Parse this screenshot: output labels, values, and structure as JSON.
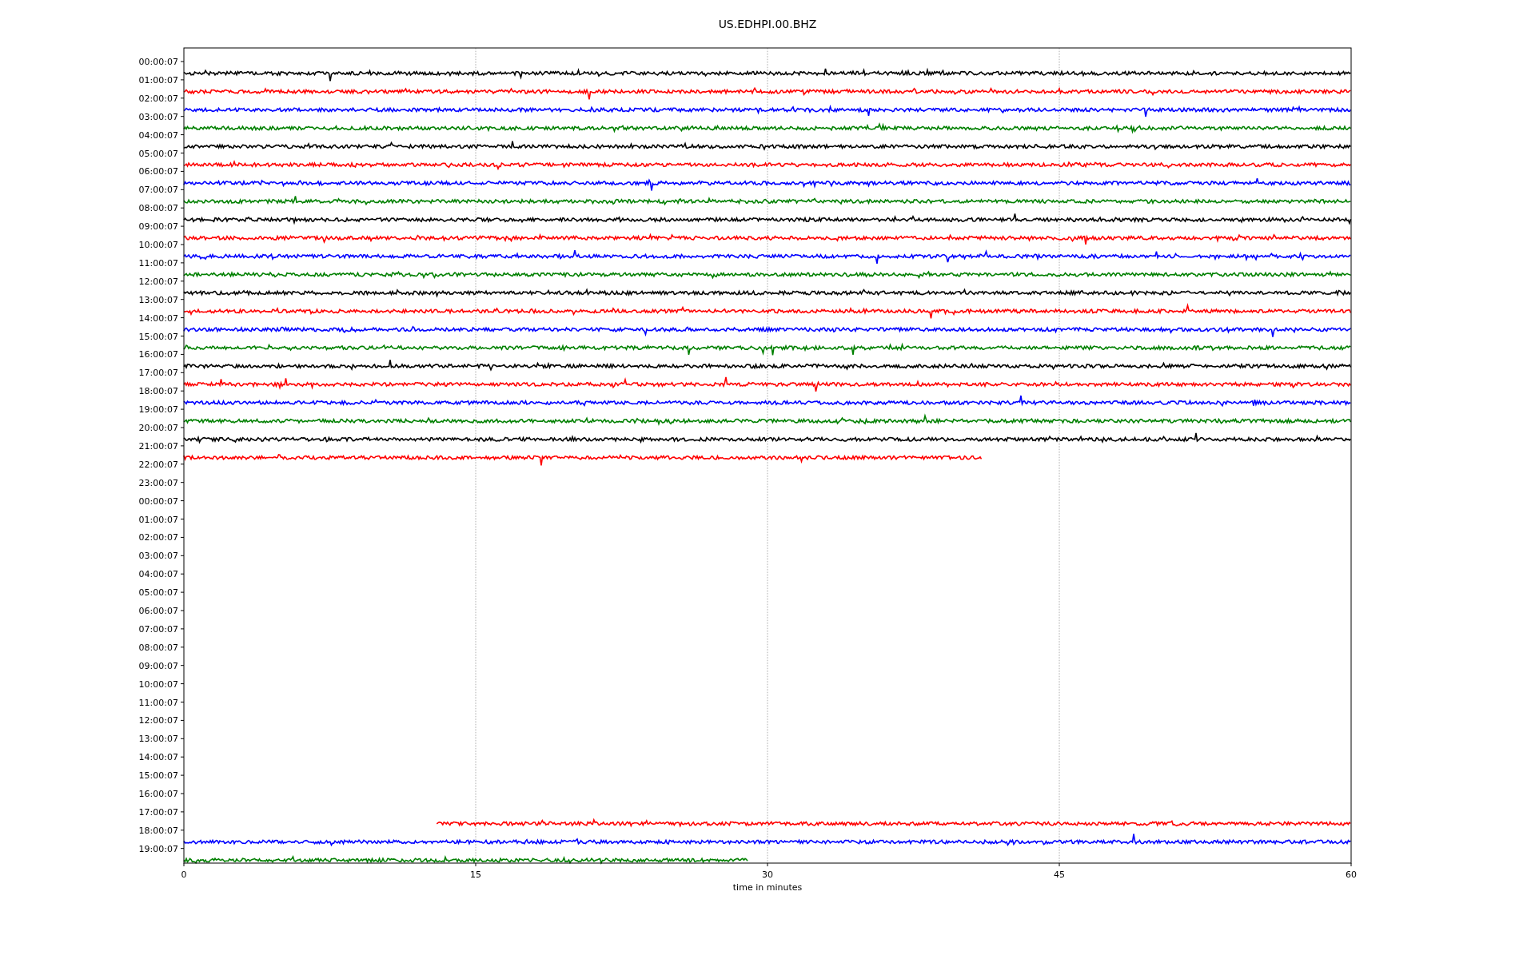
{
  "title": "US.EDHPI.00.BHZ",
  "xlabel": "time in minutes",
  "xticks": [
    "0",
    "15",
    "30",
    "45",
    "60"
  ],
  "rows": [
    {
      "label": "00:00:07",
      "trace": {
        "color": "#000000"
      }
    },
    {
      "label": "01:00:07",
      "trace": {
        "color": "#ff0000"
      }
    },
    {
      "label": "02:00:07",
      "trace": {
        "color": "#0000ff"
      }
    },
    {
      "label": "03:00:07",
      "trace": {
        "color": "#008000"
      }
    },
    {
      "label": "04:00:07",
      "trace": {
        "color": "#000000"
      }
    },
    {
      "label": "05:00:07",
      "trace": {
        "color": "#ff0000"
      }
    },
    {
      "label": "06:00:07",
      "trace": {
        "color": "#0000ff"
      }
    },
    {
      "label": "07:00:07",
      "trace": {
        "color": "#008000"
      }
    },
    {
      "label": "08:00:07",
      "trace": {
        "color": "#000000"
      }
    },
    {
      "label": "09:00:07",
      "trace": {
        "color": "#ff0000"
      }
    },
    {
      "label": "10:00:07",
      "trace": {
        "color": "#0000ff"
      }
    },
    {
      "label": "11:00:07",
      "trace": {
        "color": "#008000"
      }
    },
    {
      "label": "12:00:07",
      "trace": {
        "color": "#000000"
      }
    },
    {
      "label": "13:00:07",
      "trace": {
        "color": "#ff0000"
      }
    },
    {
      "label": "14:00:07",
      "trace": {
        "color": "#0000ff"
      }
    },
    {
      "label": "15:00:07",
      "trace": {
        "color": "#008000"
      }
    },
    {
      "label": "16:00:07",
      "trace": {
        "color": "#000000"
      }
    },
    {
      "label": "17:00:07",
      "trace": {
        "color": "#ff0000"
      }
    },
    {
      "label": "18:00:07",
      "trace": {
        "color": "#0000ff"
      }
    },
    {
      "label": "19:00:07",
      "trace": {
        "color": "#008000"
      }
    },
    {
      "label": "20:00:07",
      "trace": {
        "color": "#000000"
      }
    },
    {
      "label": "21:00:07",
      "trace": {
        "color": "#ff0000"
      }
    },
    {
      "label": "22:00:07"
    },
    {
      "label": "23:00:07"
    },
    {
      "label": "00:00:07"
    },
    {
      "label": "01:00:07"
    },
    {
      "label": "02:00:07"
    },
    {
      "label": "03:00:07"
    },
    {
      "label": "04:00:07"
    },
    {
      "label": "05:00:07"
    },
    {
      "label": "06:00:07"
    },
    {
      "label": "07:00:07"
    },
    {
      "label": "08:00:07"
    },
    {
      "label": "09:00:07"
    },
    {
      "label": "10:00:07"
    },
    {
      "label": "11:00:07"
    },
    {
      "label": "12:00:07"
    },
    {
      "label": "13:00:07"
    },
    {
      "label": "14:00:07"
    },
    {
      "label": "15:00:07"
    },
    {
      "label": "16:00:07"
    },
    {
      "label": "17:00:07",
      "trace": {
        "color": "#ff0000"
      }
    },
    {
      "label": "18:00:07",
      "trace": {
        "color": "#0000ff"
      }
    },
    {
      "label": "19:00:07",
      "trace": {
        "color": "#008000"
      }
    }
  ]
}
